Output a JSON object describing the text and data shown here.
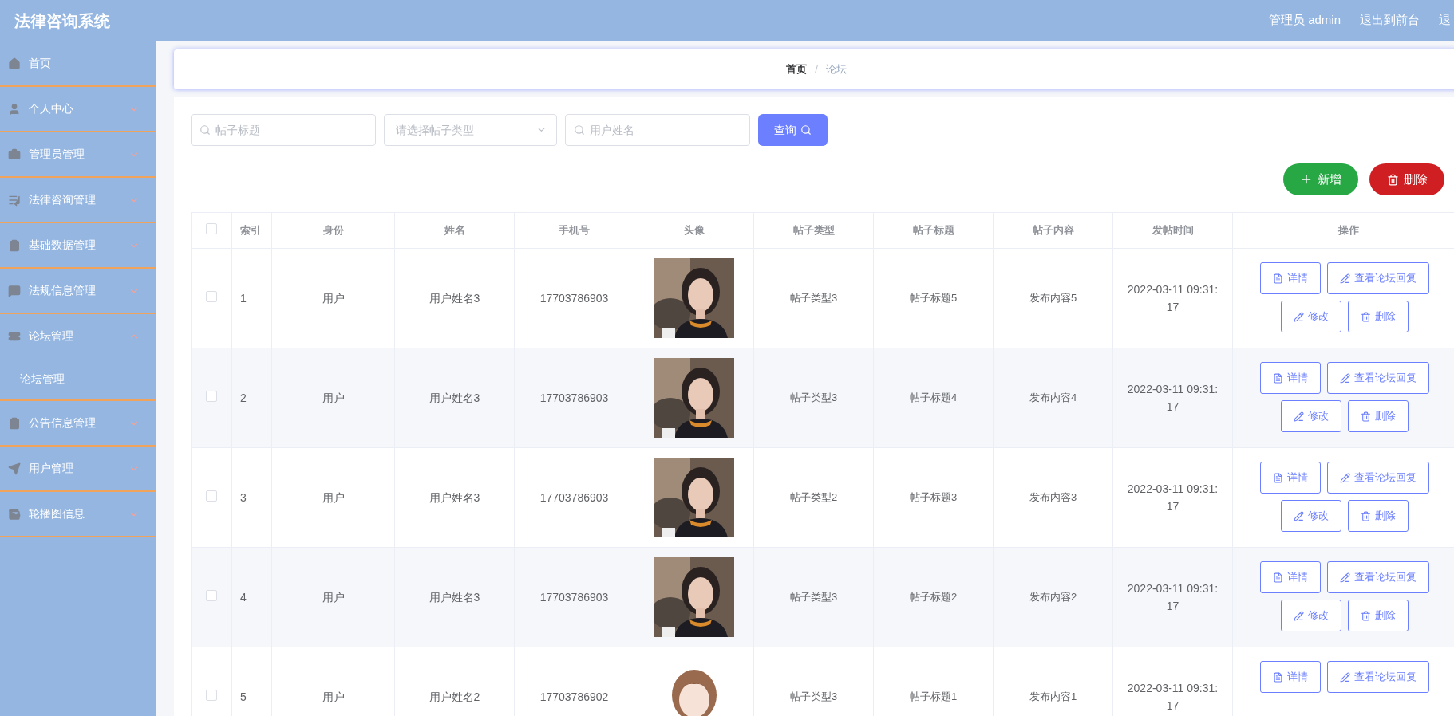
{
  "header": {
    "title": "法律咨询系统",
    "links": [
      "管理员 admin",
      "退出到前台",
      "退"
    ]
  },
  "sidebar": {
    "items": [
      {
        "kind": "link",
        "label": "首页"
      },
      {
        "kind": "menu",
        "label": "个人中心",
        "expanded": false
      },
      {
        "kind": "menu",
        "label": "管理员管理",
        "expanded": false
      },
      {
        "kind": "menu",
        "label": "法律咨询管理",
        "expanded": false
      },
      {
        "kind": "menu",
        "label": "基础数据管理",
        "expanded": false
      },
      {
        "kind": "menu",
        "label": "法规信息管理",
        "expanded": false
      },
      {
        "kind": "menu",
        "label": "论坛管理",
        "expanded": true,
        "children": [
          {
            "label": "论坛管理"
          }
        ]
      },
      {
        "kind": "menu",
        "label": "公告信息管理",
        "expanded": false
      },
      {
        "kind": "menu",
        "label": "用户管理",
        "expanded": false
      },
      {
        "kind": "menu",
        "label": "轮播图信息",
        "expanded": false
      }
    ]
  },
  "breadcrumb": {
    "separator": "/",
    "items": [
      "首页",
      "论坛"
    ]
  },
  "filters": [
    {
      "kind": "search",
      "placeholder": "帖子标题"
    },
    {
      "kind": "select",
      "placeholder": "请选择帖子类型"
    },
    {
      "kind": "search",
      "placeholder": "用户姓名"
    }
  ],
  "query_button": "查询",
  "toolbar": [
    {
      "kind": "add",
      "label": "新增"
    },
    {
      "kind": "delete",
      "label": "删除"
    }
  ],
  "table": {
    "select_all": {
      "checked": false
    },
    "columns": [
      "索引",
      "身份",
      "姓名",
      "手机号",
      "头像",
      "帖子类型",
      "帖子标题",
      "帖子内容",
      "发帖时间",
      "操作"
    ],
    "rows": [
      {
        "checked": false,
        "index": "1",
        "role": "用户",
        "name": "用户姓名3",
        "phone": "17703786903",
        "type": "帖子类型3",
        "title": "帖子标题5",
        "content": "发布内容5",
        "time": "2022-03-11 09:31:17",
        "actions": [
          {
            "kind": "detail",
            "label": "详情"
          },
          {
            "kind": "reply",
            "label": "查看论坛回复"
          },
          {
            "kind": "edit",
            "label": "修改"
          },
          {
            "kind": "delete",
            "label": "删除"
          }
        ]
      },
      {
        "checked": false,
        "index": "2",
        "role": "用户",
        "name": "用户姓名3",
        "phone": "17703786903",
        "type": "帖子类型3",
        "title": "帖子标题4",
        "content": "发布内容4",
        "time": "2022-03-11 09:31:17",
        "actions": [
          {
            "kind": "detail",
            "label": "详情"
          },
          {
            "kind": "reply",
            "label": "查看论坛回复"
          },
          {
            "kind": "edit",
            "label": "修改"
          },
          {
            "kind": "delete",
            "label": "删除"
          }
        ]
      },
      {
        "checked": false,
        "index": "3",
        "role": "用户",
        "name": "用户姓名3",
        "phone": "17703786903",
        "type": "帖子类型2",
        "title": "帖子标题3",
        "content": "发布内容3",
        "time": "2022-03-11 09:31:17",
        "actions": [
          {
            "kind": "detail",
            "label": "详情"
          },
          {
            "kind": "reply",
            "label": "查看论坛回复"
          },
          {
            "kind": "edit",
            "label": "修改"
          },
          {
            "kind": "delete",
            "label": "删除"
          }
        ]
      },
      {
        "checked": false,
        "index": "4",
        "role": "用户",
        "name": "用户姓名3",
        "phone": "17703786903",
        "type": "帖子类型3",
        "title": "帖子标题2",
        "content": "发布内容2",
        "time": "2022-03-11 09:31:17",
        "actions": [
          {
            "kind": "detail",
            "label": "详情"
          },
          {
            "kind": "reply",
            "label": "查看论坛回复"
          },
          {
            "kind": "edit",
            "label": "修改"
          },
          {
            "kind": "delete",
            "label": "删除"
          }
        ]
      },
      {
        "checked": false,
        "index": "5",
        "role": "用户",
        "name": "用户姓名2",
        "phone": "17703786902",
        "type": "帖子类型3",
        "title": "帖子标题1",
        "content": "发布内容1",
        "time": "2022-03-11 09:31:17",
        "actions": [
          {
            "kind": "detail",
            "label": "详情"
          },
          {
            "kind": "reply",
            "label": "查看论坛回复"
          }
        ]
      }
    ]
  }
}
